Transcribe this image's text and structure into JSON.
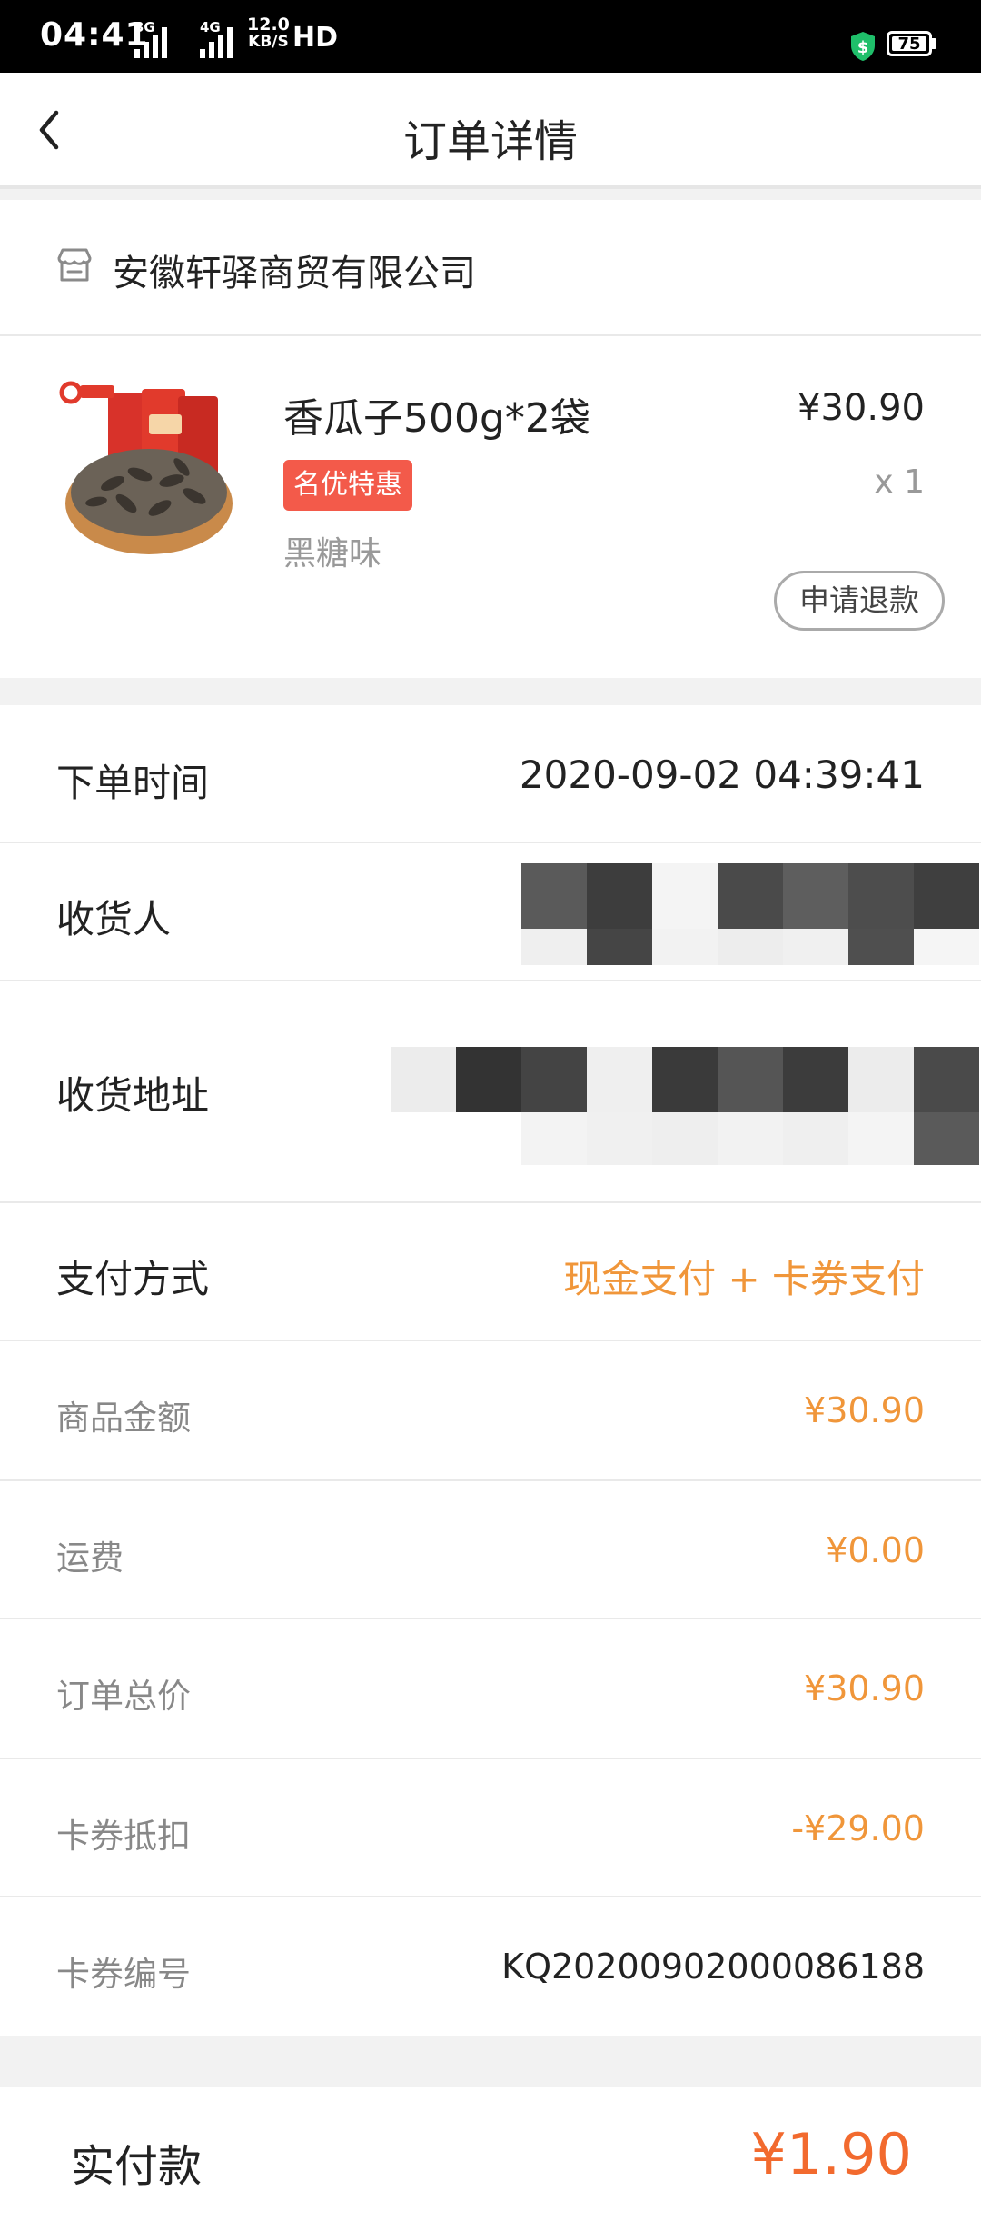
{
  "status_bar": {
    "time": "04:41",
    "network_1": "3G",
    "network_2": "4G",
    "speed_value": "12.0",
    "speed_unit": "KB/S",
    "hd": "HD",
    "battery": "75"
  },
  "header": {
    "title": "订单详情",
    "back_icon": "chevron-left-icon"
  },
  "shop": {
    "name": "安徽轩驿商贸有限公司",
    "icon": "store-icon"
  },
  "product": {
    "name": "香瓜子500g*2袋",
    "price": "¥30.90",
    "tag": "名优特惠",
    "quantity": "x 1",
    "spec": "黑糖味",
    "refund_button": "申请退款"
  },
  "order_info": {
    "order_time_label": "下单时间",
    "order_time_value": "2020-09-02 04:39:41",
    "receiver_label": "收货人",
    "address_label": "收货地址",
    "payment_label": "支付方式",
    "payment_value": "现金支付 + 卡券支付"
  },
  "amounts": {
    "goods_label": "商品金额",
    "goods_value": "¥30.90",
    "shipping_label": "运费",
    "shipping_value": "¥0.00",
    "total_label": "订单总价",
    "total_value": "¥30.90",
    "coupon_label": "卡券抵扣",
    "coupon_value": "-¥29.00",
    "coupon_no_label": "卡券编号",
    "coupon_no_value": "KQ20200902000086188"
  },
  "footer": {
    "paid_label": "实付款",
    "paid_value": "¥1.90"
  },
  "colors": {
    "accent_orange": "#f0963a",
    "price_red": "#f26a2e",
    "tag_red": "#f35a4a"
  }
}
